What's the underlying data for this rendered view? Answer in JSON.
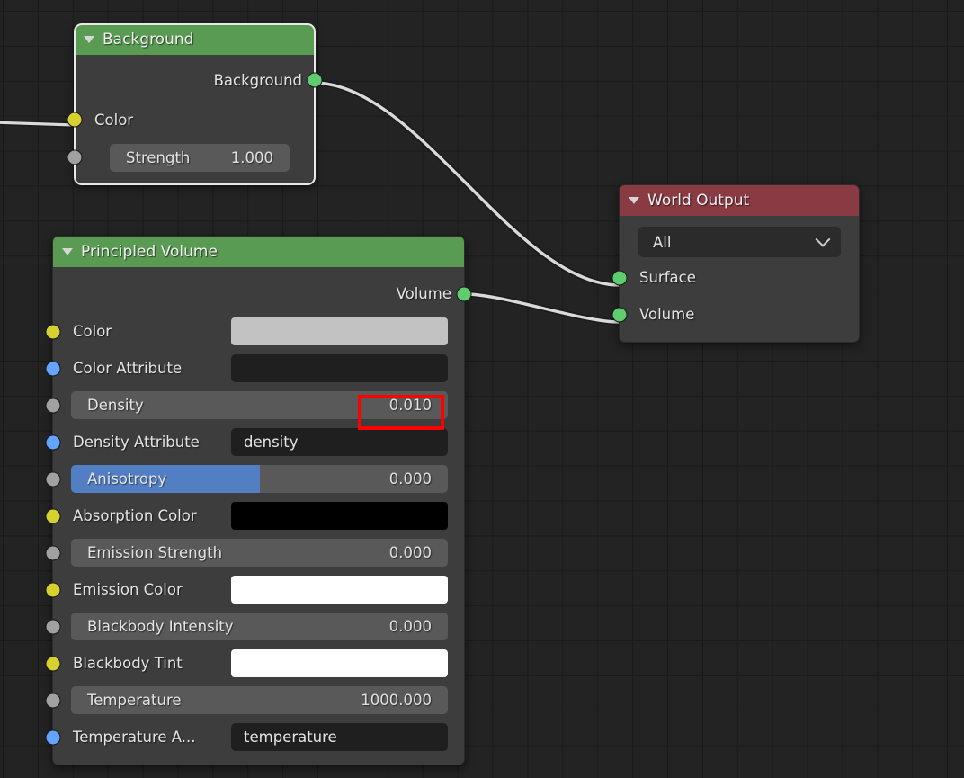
{
  "app": {
    "editor": "shader-node-editor"
  },
  "nodes": {
    "background": {
      "title": "Background",
      "collapse_icon": "triangle-down-icon",
      "outputs": [
        {
          "name": "Background",
          "socket_color": "green"
        }
      ],
      "inputs": [
        {
          "name": "Color",
          "socket_color": "yellow",
          "widget": "none"
        },
        {
          "name": "Strength",
          "socket_color": "grey",
          "widget": "value",
          "value": "1.000"
        }
      ]
    },
    "principled_volume": {
      "title": "Principled Volume",
      "collapse_icon": "triangle-down-icon",
      "outputs": [
        {
          "name": "Volume",
          "socket_color": "green"
        }
      ],
      "inputs": [
        {
          "name": "Color",
          "socket_color": "yellow",
          "widget": "swatch",
          "swatch_color": "#c2c2c2"
        },
        {
          "name": "Color Attribute",
          "socket_color": "blue",
          "widget": "text",
          "value": ""
        },
        {
          "name": "Density",
          "socket_color": "grey",
          "widget": "value",
          "value": "0.010",
          "fill": 0
        },
        {
          "name": "Density Attribute",
          "socket_color": "blue",
          "widget": "text",
          "value": "density"
        },
        {
          "name": "Anisotropy",
          "socket_color": "grey",
          "widget": "value",
          "value": "0.000",
          "fill": 50
        },
        {
          "name": "Absorption Color",
          "socket_color": "yellow",
          "widget": "swatch",
          "swatch_color": "#000000"
        },
        {
          "name": "Emission Strength",
          "socket_color": "grey",
          "widget": "value",
          "value": "0.000",
          "fill": 0
        },
        {
          "name": "Emission Color",
          "socket_color": "yellow",
          "widget": "swatch",
          "swatch_color": "#ffffff"
        },
        {
          "name": "Blackbody Intensity",
          "socket_color": "grey",
          "widget": "value",
          "value": "0.000",
          "fill": 0
        },
        {
          "name": "Blackbody Tint",
          "socket_color": "yellow",
          "widget": "swatch",
          "swatch_color": "#ffffff"
        },
        {
          "name": "Temperature",
          "socket_color": "grey",
          "widget": "value",
          "value": "1000.000",
          "fill": 0
        },
        {
          "name": "Temperature A...",
          "socket_color": "blue",
          "widget": "text",
          "value": "temperature"
        }
      ]
    },
    "world_output": {
      "title": "World Output",
      "collapse_icon": "triangle-down-icon",
      "target_dropdown": {
        "value": "All",
        "icon": "chevron-down-icon"
      },
      "inputs": [
        {
          "name": "Surface",
          "socket_color": "green"
        },
        {
          "name": "Volume",
          "socket_color": "green"
        }
      ]
    }
  },
  "annotation": {
    "highlight_target": "Density value field",
    "color": "#ff0000"
  },
  "colors": {
    "header_shader_green": "#5a9b53",
    "header_output_red": "#8a3a42",
    "node_body": "#3d3d3d",
    "canvas": "#232323",
    "socket_green": "#5fcc6f",
    "socket_yellow": "#d6d12e",
    "socket_blue": "#63a4ff",
    "socket_grey": "#a1a1a1",
    "slider_blue": "#527fc4",
    "noodle": "#d9d9d9"
  }
}
